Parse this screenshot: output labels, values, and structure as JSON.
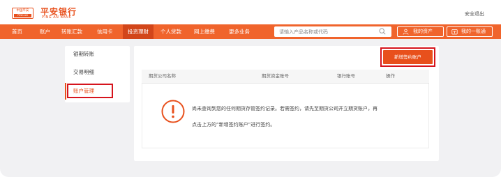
{
  "header": {
    "logo_mark_top": "中国平安",
    "logo_mark_bottom": "PING AN",
    "bank_name_cn": "平安银行",
    "bank_name_en": "PING AN BANK",
    "logout_label": "安全退出"
  },
  "nav": {
    "items": [
      {
        "label": "首页"
      },
      {
        "label": "账户"
      },
      {
        "label": "转账汇款"
      },
      {
        "label": "信用卡"
      },
      {
        "label": "投资理财",
        "active": true
      },
      {
        "label": "个人贷款"
      },
      {
        "label": "网上缴费"
      },
      {
        "label": "更多业务"
      }
    ],
    "search_placeholder": "请输入产品名称或代码",
    "my_assets_label": "我的资产",
    "my_account_label": "我的一账通"
  },
  "side_menu": {
    "items": [
      {
        "label": "银期转账"
      },
      {
        "label": "交易明细"
      },
      {
        "label": "账户管理",
        "active": true
      }
    ]
  },
  "main": {
    "new_signing_button": "新增签约账户",
    "table_headers": [
      "期货公司名称",
      "期货资金账号",
      "银行账号",
      "操作"
    ],
    "empty_message_line1": "尚未查询到您的任何期货存管签约记录。若需签约，请先至期货公司开立期货账户，再",
    "empty_message_line2": "点击上方的“新增签约账户”进行签约。"
  },
  "colors": {
    "brand": "#f0642c",
    "brand_dark": "#d2461a",
    "highlight_box": "#d6141d"
  }
}
